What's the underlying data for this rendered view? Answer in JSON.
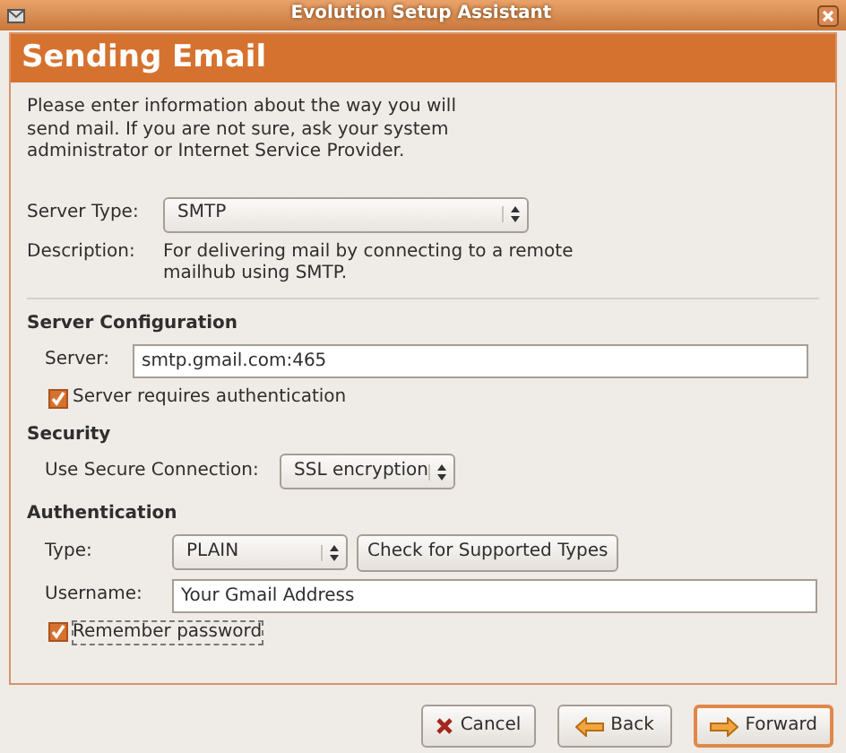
{
  "window": {
    "title": "Evolution Setup Assistant"
  },
  "page": {
    "title": "Sending Email",
    "intro": "Please enter information about the way you will send mail. If you are not sure, ask your system administrator or Internet Service Provider."
  },
  "server_type": {
    "label": "Server Type:",
    "value": "SMTP"
  },
  "description": {
    "label": "Description:",
    "text": "For delivering mail by connecting to a remote mailhub using SMTP."
  },
  "server_configuration": {
    "heading": "Server Configuration",
    "server_label": "Server:",
    "server_value": "smtp.gmail.com:465",
    "auth_checkbox": {
      "label": "Server requires authentication",
      "checked": true
    }
  },
  "security": {
    "heading": "Security",
    "label": "Use Secure Connection:",
    "value": "SSL encryption"
  },
  "authentication": {
    "heading": "Authentication",
    "type_label": "Type:",
    "type_value": "PLAIN",
    "check_button": "Check for Supported Types",
    "username_label": "Username:",
    "username_value": "Your Gmail Address",
    "remember": {
      "label": "Remember password",
      "checked": true
    }
  },
  "buttons": [
    {
      "kind": "cancel",
      "label": "Cancel",
      "default": false
    },
    {
      "kind": "back",
      "label": "Back",
      "default": false
    },
    {
      "kind": "forward",
      "label": "Forward",
      "default": true
    }
  ]
}
